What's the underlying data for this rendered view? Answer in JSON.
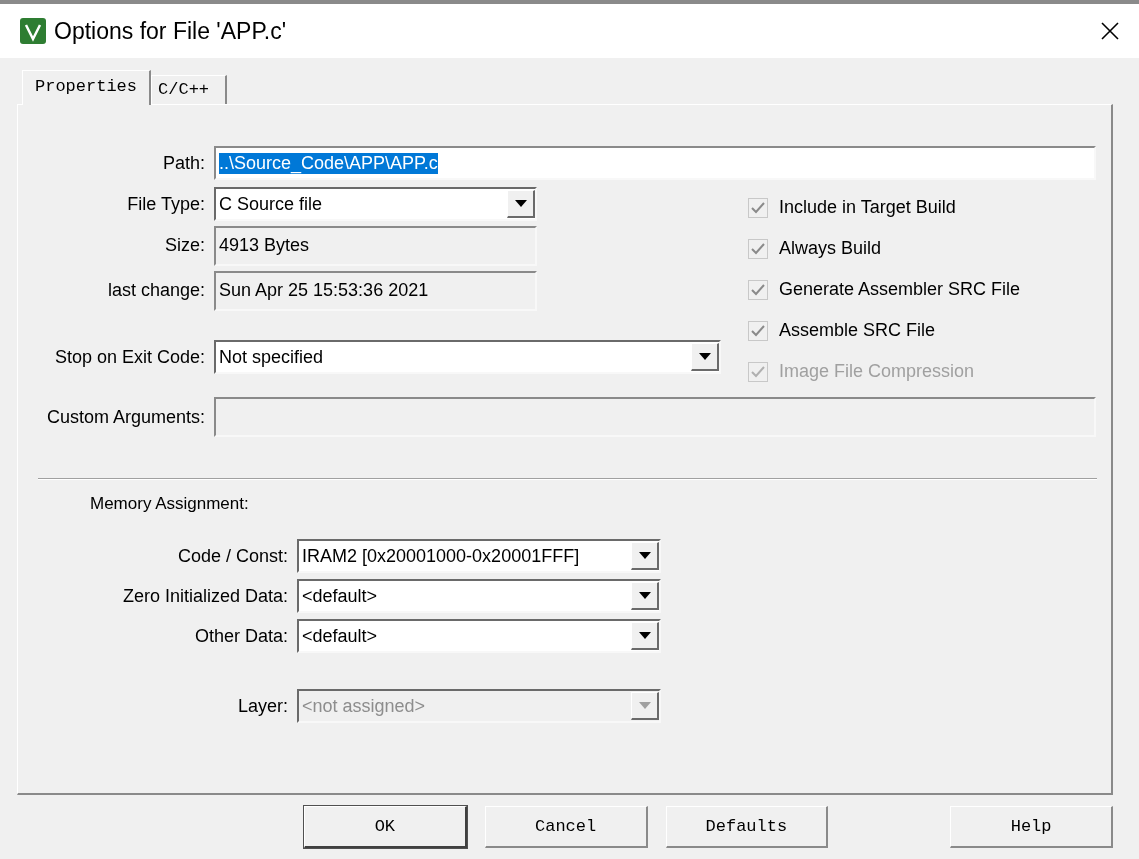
{
  "window": {
    "title": "Options for File 'APP.c'"
  },
  "tabs": [
    {
      "label": "Properties",
      "selected": true
    },
    {
      "label": "C/C++",
      "selected": false
    }
  ],
  "path": {
    "label": "Path:",
    "value": "..\\Source_Code\\APP\\APP.c",
    "highlighted": true
  },
  "fields": [
    {
      "kind": "combo",
      "label": "File Type:",
      "value": "C Source file",
      "disabled": false
    },
    {
      "kind": "readonly",
      "label": "Size:",
      "value": "4913 Bytes"
    },
    {
      "kind": "readonly",
      "label": "last change:",
      "value": "Sun Apr 25 15:53:36 2021"
    },
    {
      "kind": "gap"
    },
    {
      "kind": "wide-combo",
      "label": "Stop on Exit Code:",
      "value": "Not specified",
      "disabled": false
    }
  ],
  "options": [
    {
      "label": "Include in Target Build",
      "checked": true,
      "disabled": false
    },
    {
      "label": "Always Build",
      "checked": true,
      "disabled": false
    },
    {
      "label": "Generate Assembler SRC File",
      "checked": true,
      "disabled": false
    },
    {
      "label": "Assemble SRC File",
      "checked": true,
      "disabled": false
    },
    {
      "label": "Image File Compression",
      "checked": true,
      "disabled": true
    }
  ],
  "custom_arguments": {
    "label": "Custom Arguments:"
  },
  "memory": {
    "heading": "Memory Assignment:",
    "rows": [
      {
        "label": "Code / Const:",
        "value": "IRAM2 [0x20001000-0x20001FFF]",
        "disabled": false
      },
      {
        "label": "Zero Initialized Data:",
        "value": "<default>",
        "disabled": false
      },
      {
        "label": "Other Data:",
        "value": "<default>",
        "disabled": false
      },
      {
        "label": "Layer:",
        "value": "<not assigned>",
        "disabled": true
      }
    ]
  },
  "buttons": [
    {
      "label": "OK",
      "default": true
    },
    {
      "label": "Cancel",
      "default": false
    },
    {
      "label": "Defaults",
      "default": false
    },
    {
      "label": "Help",
      "default": false
    }
  ]
}
